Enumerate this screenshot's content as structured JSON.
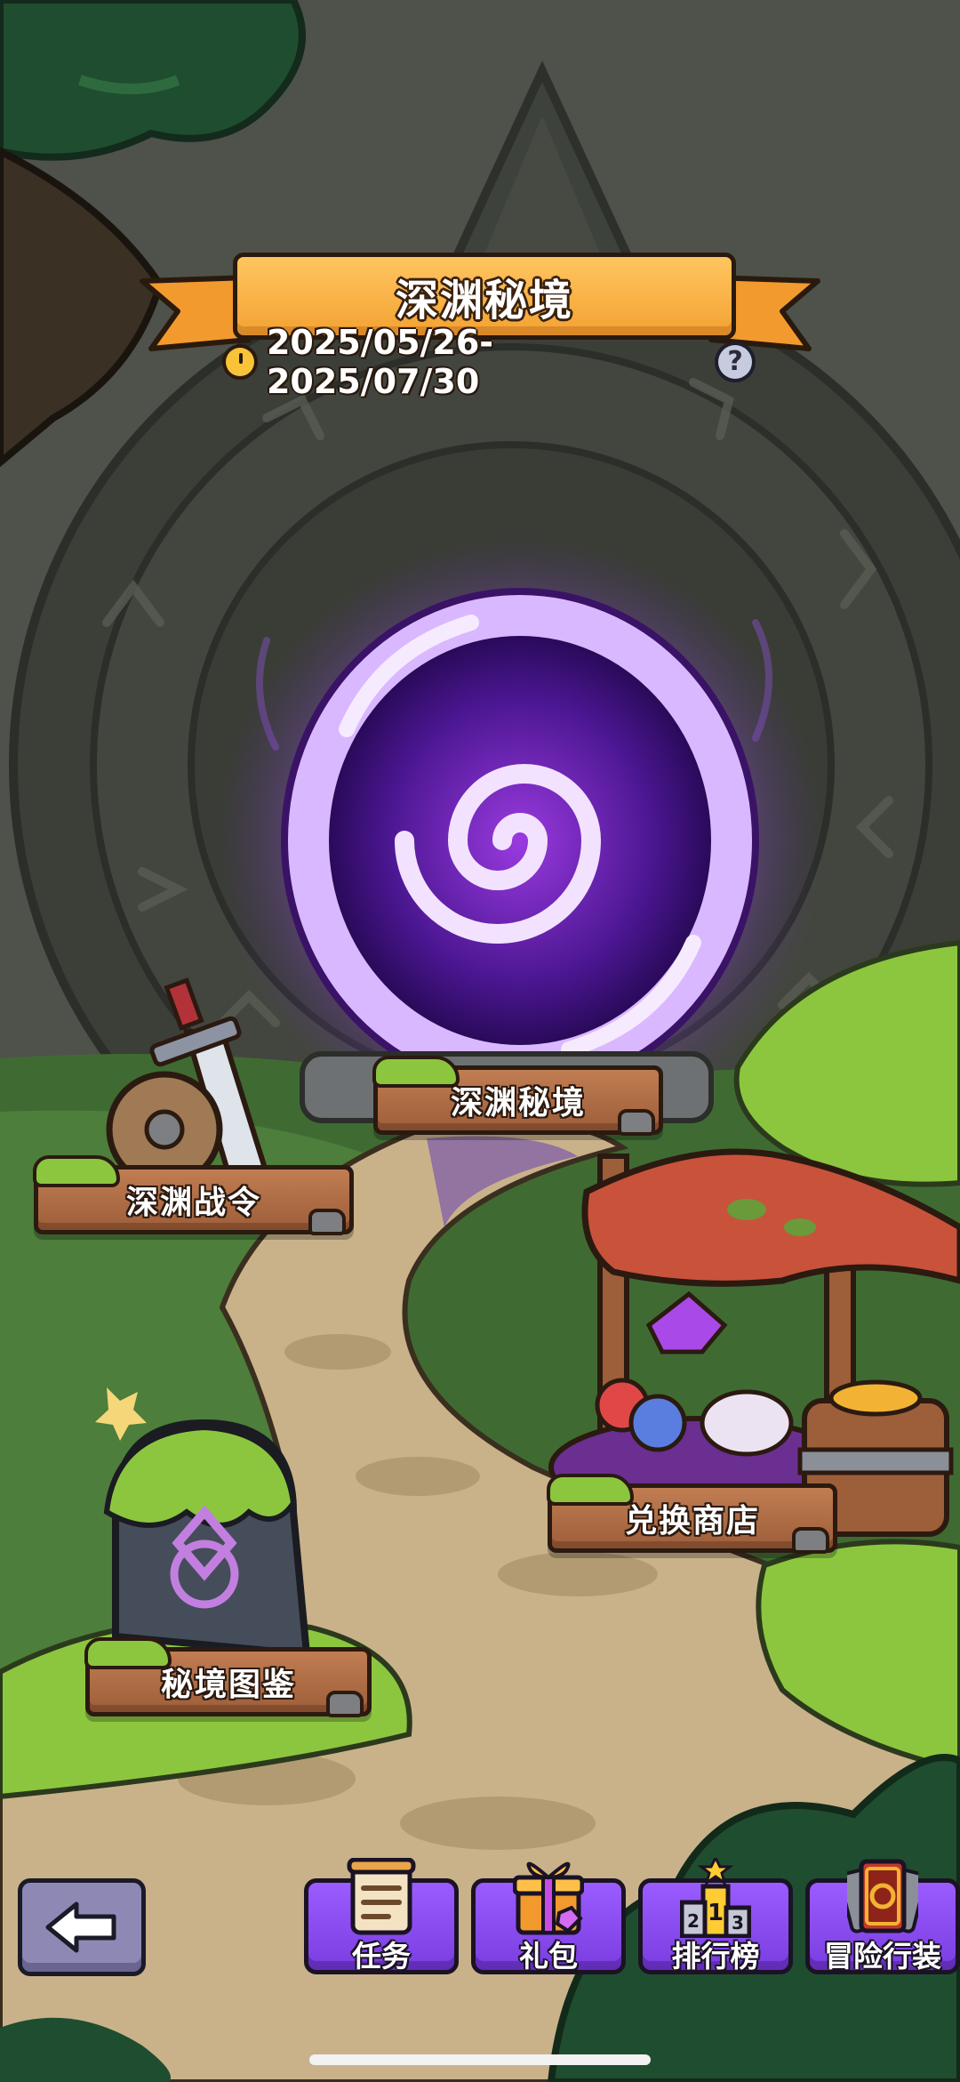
{
  "header": {
    "title": "深渊秘境",
    "date_range": "2025/05/26-2025/07/30",
    "help_glyph": "?"
  },
  "signs": {
    "portal": "深渊秘境",
    "battle_pass": "深渊战令",
    "shop": "兑换商店",
    "codex": "秘境图鉴"
  },
  "bottom_bar": {
    "tasks": "任务",
    "gift": "礼包",
    "ranking": "排行榜",
    "outfit": "冒险行装",
    "ranking_digits": {
      "first": "1",
      "second": "2",
      "third": "3"
    }
  },
  "icons": {
    "back": "back-arrow-icon",
    "timer": "stopwatch-icon",
    "help": "question-mark-icon",
    "tasks": "scroll-icon",
    "gift": "gift-box-icon",
    "ranking": "podium-icon",
    "outfit": "card-icon"
  },
  "colors": {
    "banner": "#f7ae3e",
    "portal": "#7a2fd0",
    "nav_button": "#8c4cf2",
    "back_button": "#8e89b4",
    "sign_wood": "#b06f48",
    "grass": "#6ea43a"
  }
}
